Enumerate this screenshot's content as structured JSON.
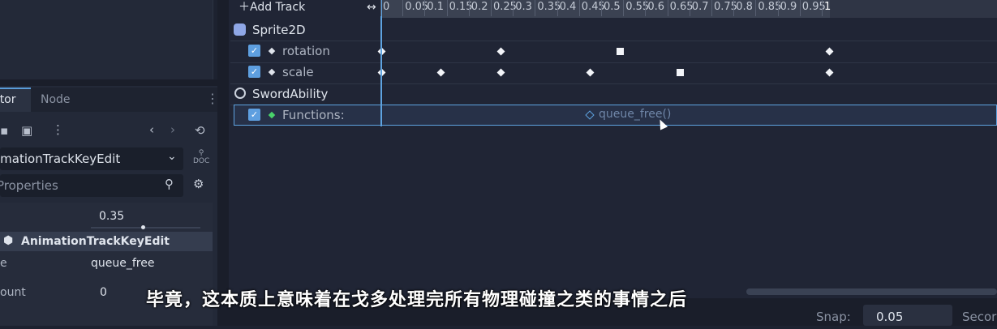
{
  "inspector": {
    "tabs": [
      "ctor",
      "Node"
    ],
    "menu_icon": "kebab-menu-icon",
    "toolbar_icons": [
      "open-icon",
      "save-icon",
      "more-icon",
      "back-icon",
      "forward-icon",
      "history-icon"
    ],
    "object_type": "imationTrackKeyEdit",
    "doc_label": "DOC",
    "filter_placeholder": "Properties",
    "slider_value": "0.35",
    "section_title": "AnimationTrackKeyEdit",
    "props": [
      {
        "label": "e",
        "value": "queue_free"
      },
      {
        "label": "ount",
        "value": "0"
      }
    ]
  },
  "timeline": {
    "add_track": "Add Track",
    "ticks": [
      "0",
      "0.05",
      "0.1",
      "0.15",
      "0.2",
      "0.25",
      "0.3",
      "0.35",
      "0.4",
      "0.45",
      "0.5",
      "0.55",
      "0.6",
      "0.65",
      "0.7",
      "0.75",
      "0.8",
      "0.85",
      "0.9",
      "0.95",
      "1"
    ],
    "groups": [
      {
        "name": "Sprite2D",
        "tracks": [
          "rotation",
          "scale"
        ]
      },
      {
        "name": "SwordAbility",
        "tracks": [
          "Functions:"
        ]
      }
    ],
    "function_key": "queue_free()",
    "playhead_time": 0
  },
  "bottom": {
    "snap_label": "Snap:",
    "snap_value": "0.05",
    "seconds_label": "Secor"
  },
  "subtitle": "毕竟，这本质上意味着在戈多处理完所有物理碰撞之类的事情之后",
  "colors": {
    "accent": "#5ea3e0",
    "bg": "#202535"
  }
}
